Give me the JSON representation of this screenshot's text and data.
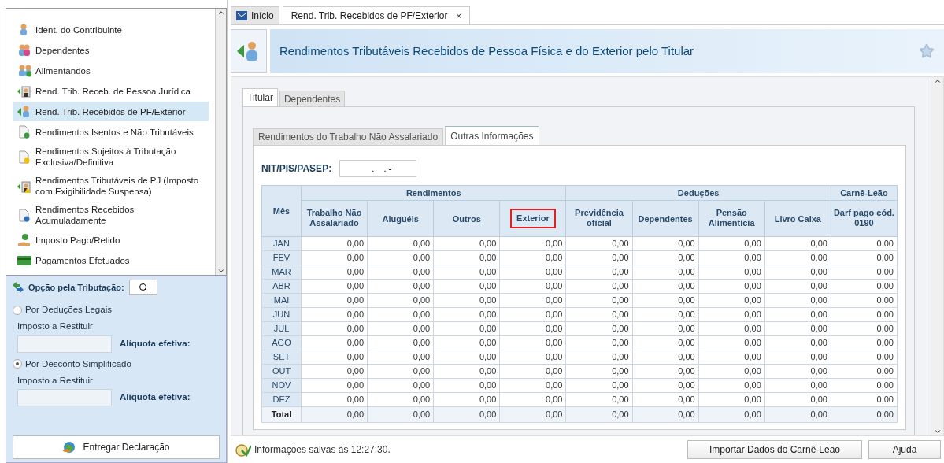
{
  "sidebar": {
    "items": [
      {
        "label": "Ident. do Contribuinte",
        "kind": "person",
        "selected": false
      },
      {
        "label": "Dependentes",
        "kind": "people",
        "selected": false
      },
      {
        "label": "Alimentandos",
        "kind": "people-plus",
        "selected": false
      },
      {
        "label": "Rend. Trib. Receb. de Pessoa Jurídica",
        "kind": "arrow-suit",
        "selected": false
      },
      {
        "label": "Rend. Trib. Recebidos de PF/Exterior",
        "kind": "arrow-person",
        "selected": true
      },
      {
        "label": "Rendimentos Isentos e Não Tributáveis",
        "kind": "doc-check",
        "selected": false
      },
      {
        "label": "Rendimentos Sujeitos à Tributação Exclusiva/Definitiva",
        "kind": "doc-warning",
        "selected": false
      },
      {
        "label": "Rendimentos Tributáveis de PJ (Imposto com Exigibilidade Suspensa)",
        "kind": "arrow-suit-warning",
        "selected": false
      },
      {
        "label": "Rendimentos Recebidos Acumuladamente",
        "kind": "doc-search",
        "selected": false
      },
      {
        "label": "Imposto Pago/Retido",
        "kind": "hand-coin",
        "selected": false
      },
      {
        "label": "Pagamentos Efetuados",
        "kind": "card",
        "selected": false
      }
    ],
    "option_title": "Opção pela Tributação:",
    "options": [
      {
        "label": "Por Deduções Legais",
        "selected": false,
        "field_label": "Imposto a Restituir",
        "rate_label": "Alíquota efetiva:"
      },
      {
        "label": "Por Desconto Simplificado",
        "selected": true,
        "field_label": "Imposto a Restituir",
        "rate_label": "Alíquota efetiva:"
      }
    ],
    "submit_button": "Entregar Declaração"
  },
  "tabs": [
    {
      "label": "Início",
      "selected": false,
      "closable": false
    },
    {
      "label": "Rend. Trib. Recebidos de PF/Exterior",
      "selected": true,
      "closable": true
    }
  ],
  "close_glyph": "×",
  "page_title": "Rendimentos Tributáveis Recebidos de Pessoa Física e do Exterior pelo Titular",
  "person_tabs": [
    {
      "label": "Titular",
      "selected": true
    },
    {
      "label": "Dependentes",
      "selected": false
    }
  ],
  "sub_tabs": [
    {
      "label": "Rendimentos do Trabalho Não Assalariado",
      "selected": false
    },
    {
      "label": "Outras Informações",
      "selected": true
    }
  ],
  "nit": {
    "label": "NIT/PIS/PASEP:",
    "value": "   .    . -"
  },
  "table": {
    "month_header": "Mês",
    "groups": [
      {
        "label": "Rendimentos",
        "columns": [
          {
            "label": "Trabalho Não Assalariado",
            "highlighted": false
          },
          {
            "label": "Aluguéis",
            "highlighted": false
          },
          {
            "label": "Outros",
            "highlighted": false
          },
          {
            "label": "Exterior",
            "highlighted": true
          }
        ]
      },
      {
        "label": "Deduções",
        "columns": [
          {
            "label": "Previdência oficial",
            "highlighted": false
          },
          {
            "label": "Dependentes",
            "highlighted": false
          },
          {
            "label": "Pensão Alimentícia",
            "highlighted": false
          },
          {
            "label": "Livro Caixa",
            "highlighted": false
          }
        ]
      },
      {
        "label": "Carnê-Leão",
        "columns": [
          {
            "label": "Darf pago cód. 0190",
            "highlighted": false
          }
        ]
      }
    ],
    "rows": [
      {
        "month": "JAN",
        "values": [
          "0,00",
          "0,00",
          "0,00",
          "0,00",
          "0,00",
          "0,00",
          "0,00",
          "0,00",
          "0,00"
        ]
      },
      {
        "month": "FEV",
        "values": [
          "0,00",
          "0,00",
          "0,00",
          "0,00",
          "0,00",
          "0,00",
          "0,00",
          "0,00",
          "0,00"
        ]
      },
      {
        "month": "MAR",
        "values": [
          "0,00",
          "0,00",
          "0,00",
          "0,00",
          "0,00",
          "0,00",
          "0,00",
          "0,00",
          "0,00"
        ]
      },
      {
        "month": "ABR",
        "values": [
          "0,00",
          "0,00",
          "0,00",
          "0,00",
          "0,00",
          "0,00",
          "0,00",
          "0,00",
          "0,00"
        ]
      },
      {
        "month": "MAI",
        "values": [
          "0,00",
          "0,00",
          "0,00",
          "0,00",
          "0,00",
          "0,00",
          "0,00",
          "0,00",
          "0,00"
        ]
      },
      {
        "month": "JUN",
        "values": [
          "0,00",
          "0,00",
          "0,00",
          "0,00",
          "0,00",
          "0,00",
          "0,00",
          "0,00",
          "0,00"
        ]
      },
      {
        "month": "JUL",
        "values": [
          "0,00",
          "0,00",
          "0,00",
          "0,00",
          "0,00",
          "0,00",
          "0,00",
          "0,00",
          "0,00"
        ]
      },
      {
        "month": "AGO",
        "values": [
          "0,00",
          "0,00",
          "0,00",
          "0,00",
          "0,00",
          "0,00",
          "0,00",
          "0,00",
          "0,00"
        ]
      },
      {
        "month": "SET",
        "values": [
          "0,00",
          "0,00",
          "0,00",
          "0,00",
          "0,00",
          "0,00",
          "0,00",
          "0,00",
          "0,00"
        ]
      },
      {
        "month": "OUT",
        "values": [
          "0,00",
          "0,00",
          "0,00",
          "0,00",
          "0,00",
          "0,00",
          "0,00",
          "0,00",
          "0,00"
        ]
      },
      {
        "month": "NOV",
        "values": [
          "0,00",
          "0,00",
          "0,00",
          "0,00",
          "0,00",
          "0,00",
          "0,00",
          "0,00",
          "0,00"
        ]
      },
      {
        "month": "DEZ",
        "values": [
          "0,00",
          "0,00",
          "0,00",
          "0,00",
          "0,00",
          "0,00",
          "0,00",
          "0,00",
          "0,00"
        ]
      }
    ],
    "total": {
      "label": "Total",
      "values": [
        "0,00",
        "0,00",
        "0,00",
        "0,00",
        "0,00",
        "0,00",
        "0,00",
        "0,00",
        "0,00"
      ]
    }
  },
  "status": "Informações salvas às 12:27:30.",
  "buttons": [
    "Importar Dados do Carnê-Leão",
    "Ajuda"
  ]
}
